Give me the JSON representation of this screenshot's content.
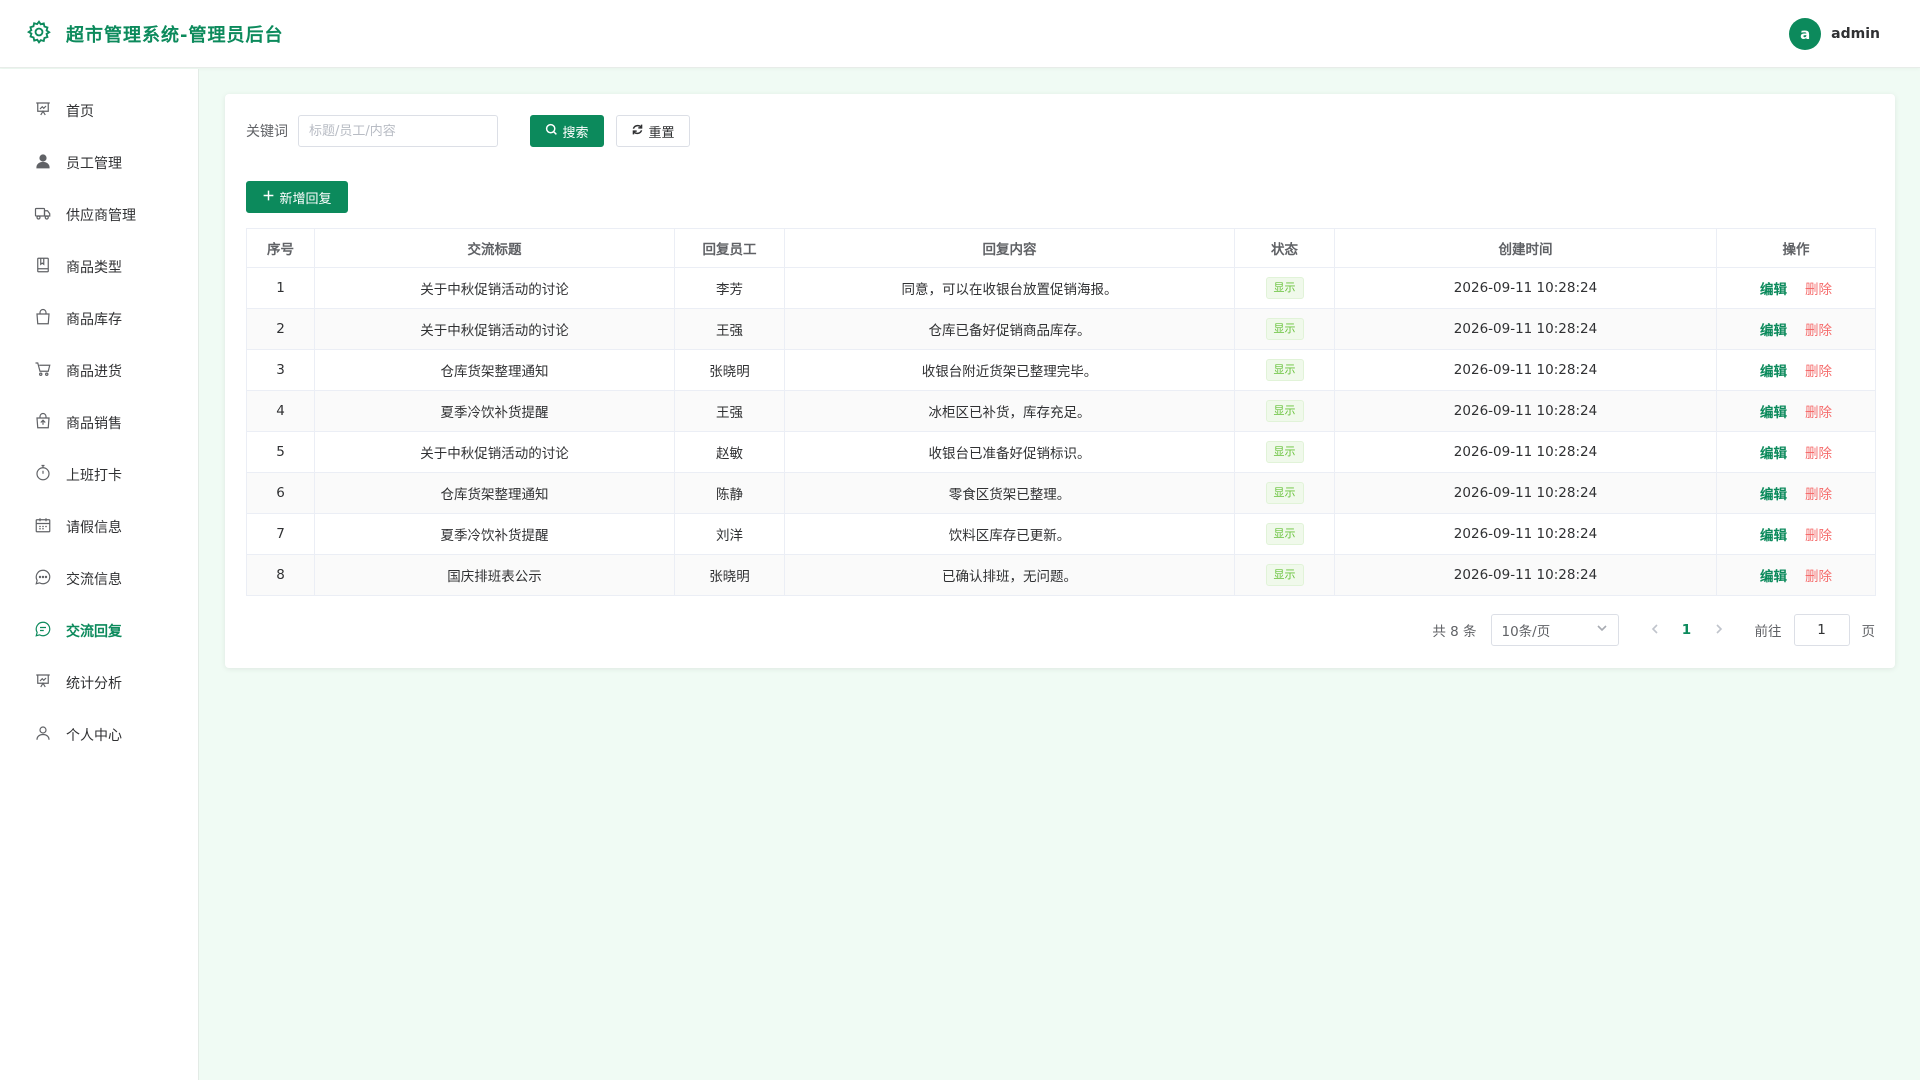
{
  "header": {
    "title": "超市管理系统-管理员后台",
    "logo_icon": "gear-icon",
    "avatar_letter": "a",
    "username": "admin"
  },
  "colors": {
    "primary": "#0c8a5c",
    "background": "#f0fbf4",
    "danger": "#f56c6c",
    "tag_green": "#67c23a"
  },
  "sidebar": {
    "items": [
      {
        "label": "首页",
        "icon": "dashboard-icon"
      },
      {
        "label": "员工管理",
        "icon": "user-icon"
      },
      {
        "label": "供应商管理",
        "icon": "truck-icon"
      },
      {
        "label": "商品类型",
        "icon": "notebook-icon"
      },
      {
        "label": "商品库存",
        "icon": "bag-icon"
      },
      {
        "label": "商品进货",
        "icon": "cart-icon"
      },
      {
        "label": "商品销售",
        "icon": "sell-icon"
      },
      {
        "label": "上班打卡",
        "icon": "stopwatch-icon"
      },
      {
        "label": "请假信息",
        "icon": "calendar-icon"
      },
      {
        "label": "交流信息",
        "icon": "chat-icon"
      },
      {
        "label": "交流回复",
        "icon": "chat-dots-icon",
        "active": true
      },
      {
        "label": "统计分析",
        "icon": "chart-icon"
      },
      {
        "label": "个人中心",
        "icon": "person-icon"
      }
    ]
  },
  "filter": {
    "keyword_label": "关键词",
    "keyword_placeholder": "标题/员工/内容",
    "keyword_value": "",
    "search_label": "搜索",
    "reset_label": "重置"
  },
  "add_button_label": "新增回复",
  "table": {
    "columns": [
      "序号",
      "交流标题",
      "回复员工",
      "回复内容",
      "状态",
      "创建时间",
      "操作"
    ],
    "edit_label": "编辑",
    "delete_label": "删除",
    "rows": [
      {
        "index": "1",
        "title": "关于中秋促销活动的讨论",
        "employee": "李芳",
        "content": "同意，可以在收银台放置促销海报。",
        "status": "显示",
        "created": "2026-09-11 10:28:24"
      },
      {
        "index": "2",
        "title": "关于中秋促销活动的讨论",
        "employee": "王强",
        "content": "仓库已备好促销商品库存。",
        "status": "显示",
        "created": "2026-09-11 10:28:24"
      },
      {
        "index": "3",
        "title": "仓库货架整理通知",
        "employee": "张晓明",
        "content": "收银台附近货架已整理完毕。",
        "status": "显示",
        "created": "2026-09-11 10:28:24"
      },
      {
        "index": "4",
        "title": "夏季冷饮补货提醒",
        "employee": "王强",
        "content": "冰柜区已补货，库存充足。",
        "status": "显示",
        "created": "2026-09-11 10:28:24"
      },
      {
        "index": "5",
        "title": "关于中秋促销活动的讨论",
        "employee": "赵敏",
        "content": "收银台已准备好促销标识。",
        "status": "显示",
        "created": "2026-09-11 10:28:24"
      },
      {
        "index": "6",
        "title": "仓库货架整理通知",
        "employee": "陈静",
        "content": "零食区货架已整理。",
        "status": "显示",
        "created": "2026-09-11 10:28:24"
      },
      {
        "index": "7",
        "title": "夏季冷饮补货提醒",
        "employee": "刘洋",
        "content": "饮料区库存已更新。",
        "status": "显示",
        "created": "2026-09-11 10:28:24"
      },
      {
        "index": "8",
        "title": "国庆排班表公示",
        "employee": "张晓明",
        "content": "已确认排班，无问题。",
        "status": "显示",
        "created": "2026-09-11 10:28:24"
      }
    ]
  },
  "pagination": {
    "total_text": "共 8 条",
    "page_size": "10条/页",
    "current_page": "1",
    "goto_label": "前往",
    "goto_value": "1",
    "page_unit": "页"
  }
}
